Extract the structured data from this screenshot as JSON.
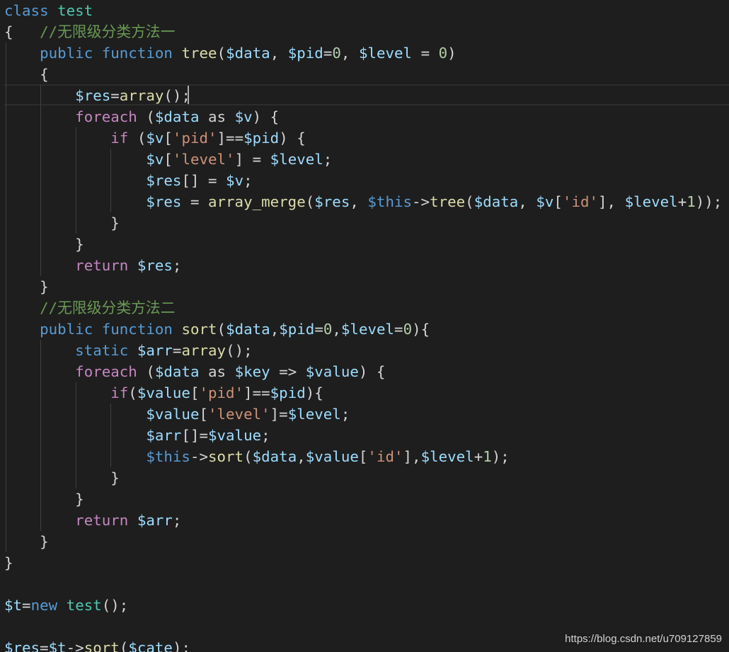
{
  "colors": {
    "background": "#1e1e1e",
    "keyword": "#569cd6",
    "control": "#c586c0",
    "class_name": "#4ec9b0",
    "function_name": "#dcdcaa",
    "variable": "#9cdcfe",
    "string": "#ce9178",
    "number": "#b5cea8",
    "comment": "#6a9955",
    "text": "#d4d4d4"
  },
  "code_lines": [
    [
      {
        "t": "kw",
        "v": "class"
      },
      {
        "t": "punc",
        "v": " "
      },
      {
        "t": "cls",
        "v": "test"
      }
    ],
    [
      {
        "t": "punc",
        "v": "{   "
      },
      {
        "t": "cmt",
        "v": "//无限级分类方法一"
      }
    ],
    [
      {
        "t": "punc",
        "v": "    "
      },
      {
        "t": "kw",
        "v": "public"
      },
      {
        "t": "punc",
        "v": " "
      },
      {
        "t": "kw",
        "v": "function"
      },
      {
        "t": "punc",
        "v": " "
      },
      {
        "t": "fn",
        "v": "tree"
      },
      {
        "t": "punc",
        "v": "("
      },
      {
        "t": "var",
        "v": "$data"
      },
      {
        "t": "punc",
        "v": ", "
      },
      {
        "t": "var",
        "v": "$pid"
      },
      {
        "t": "punc",
        "v": "="
      },
      {
        "t": "num",
        "v": "0"
      },
      {
        "t": "punc",
        "v": ", "
      },
      {
        "t": "var",
        "v": "$level"
      },
      {
        "t": "punc",
        "v": " = "
      },
      {
        "t": "num",
        "v": "0"
      },
      {
        "t": "punc",
        "v": ")"
      }
    ],
    [
      {
        "t": "punc",
        "v": "    {"
      }
    ],
    [
      {
        "t": "punc",
        "v": "        "
      },
      {
        "t": "var",
        "v": "$res"
      },
      {
        "t": "punc",
        "v": "="
      },
      {
        "t": "fn",
        "v": "array"
      },
      {
        "t": "punc",
        "v": "();"
      }
    ],
    [
      {
        "t": "punc",
        "v": "        "
      },
      {
        "t": "ctrl",
        "v": "foreach"
      },
      {
        "t": "punc",
        "v": " ("
      },
      {
        "t": "var",
        "v": "$data"
      },
      {
        "t": "punc",
        "v": " as "
      },
      {
        "t": "var",
        "v": "$v"
      },
      {
        "t": "punc",
        "v": ") {"
      }
    ],
    [
      {
        "t": "punc",
        "v": "            "
      },
      {
        "t": "ctrl",
        "v": "if"
      },
      {
        "t": "punc",
        "v": " ("
      },
      {
        "t": "var",
        "v": "$v"
      },
      {
        "t": "punc",
        "v": "["
      },
      {
        "t": "str",
        "v": "'pid'"
      },
      {
        "t": "punc",
        "v": "]=="
      },
      {
        "t": "var",
        "v": "$pid"
      },
      {
        "t": "punc",
        "v": ") {"
      }
    ],
    [
      {
        "t": "punc",
        "v": "                "
      },
      {
        "t": "var",
        "v": "$v"
      },
      {
        "t": "punc",
        "v": "["
      },
      {
        "t": "str",
        "v": "'level'"
      },
      {
        "t": "punc",
        "v": "] = "
      },
      {
        "t": "var",
        "v": "$level"
      },
      {
        "t": "punc",
        "v": ";"
      }
    ],
    [
      {
        "t": "punc",
        "v": "                "
      },
      {
        "t": "var",
        "v": "$res"
      },
      {
        "t": "punc",
        "v": "[] = "
      },
      {
        "t": "var",
        "v": "$v"
      },
      {
        "t": "punc",
        "v": ";"
      }
    ],
    [
      {
        "t": "punc",
        "v": "                "
      },
      {
        "t": "var",
        "v": "$res"
      },
      {
        "t": "punc",
        "v": " = "
      },
      {
        "t": "fn",
        "v": "array_merge"
      },
      {
        "t": "punc",
        "v": "("
      },
      {
        "t": "var",
        "v": "$res"
      },
      {
        "t": "punc",
        "v": ", "
      },
      {
        "t": "this",
        "v": "$this"
      },
      {
        "t": "punc",
        "v": "->"
      },
      {
        "t": "fn",
        "v": "tree"
      },
      {
        "t": "punc",
        "v": "("
      },
      {
        "t": "var",
        "v": "$data"
      },
      {
        "t": "punc",
        "v": ", "
      },
      {
        "t": "var",
        "v": "$v"
      },
      {
        "t": "punc",
        "v": "["
      },
      {
        "t": "str",
        "v": "'id'"
      },
      {
        "t": "punc",
        "v": "], "
      },
      {
        "t": "var",
        "v": "$level"
      },
      {
        "t": "punc",
        "v": "+"
      },
      {
        "t": "num",
        "v": "1"
      },
      {
        "t": "punc",
        "v": "));"
      }
    ],
    [
      {
        "t": "punc",
        "v": "            }"
      }
    ],
    [
      {
        "t": "punc",
        "v": "        }"
      }
    ],
    [
      {
        "t": "punc",
        "v": "        "
      },
      {
        "t": "ctrl",
        "v": "return"
      },
      {
        "t": "punc",
        "v": " "
      },
      {
        "t": "var",
        "v": "$res"
      },
      {
        "t": "punc",
        "v": ";"
      }
    ],
    [
      {
        "t": "punc",
        "v": "    }"
      }
    ],
    [
      {
        "t": "punc",
        "v": "    "
      },
      {
        "t": "cmt",
        "v": "//无限级分类方法二"
      }
    ],
    [
      {
        "t": "punc",
        "v": "    "
      },
      {
        "t": "kw",
        "v": "public"
      },
      {
        "t": "punc",
        "v": " "
      },
      {
        "t": "kw",
        "v": "function"
      },
      {
        "t": "punc",
        "v": " "
      },
      {
        "t": "fn",
        "v": "sort"
      },
      {
        "t": "punc",
        "v": "("
      },
      {
        "t": "var",
        "v": "$data"
      },
      {
        "t": "punc",
        "v": ","
      },
      {
        "t": "var",
        "v": "$pid"
      },
      {
        "t": "punc",
        "v": "="
      },
      {
        "t": "num",
        "v": "0"
      },
      {
        "t": "punc",
        "v": ","
      },
      {
        "t": "var",
        "v": "$level"
      },
      {
        "t": "punc",
        "v": "="
      },
      {
        "t": "num",
        "v": "0"
      },
      {
        "t": "punc",
        "v": "){"
      }
    ],
    [
      {
        "t": "punc",
        "v": "        "
      },
      {
        "t": "kw",
        "v": "static"
      },
      {
        "t": "punc",
        "v": " "
      },
      {
        "t": "var",
        "v": "$arr"
      },
      {
        "t": "punc",
        "v": "="
      },
      {
        "t": "fn",
        "v": "array"
      },
      {
        "t": "punc",
        "v": "();"
      }
    ],
    [
      {
        "t": "punc",
        "v": "        "
      },
      {
        "t": "ctrl",
        "v": "foreach"
      },
      {
        "t": "punc",
        "v": " ("
      },
      {
        "t": "var",
        "v": "$data"
      },
      {
        "t": "punc",
        "v": " as "
      },
      {
        "t": "var",
        "v": "$key"
      },
      {
        "t": "punc",
        "v": " => "
      },
      {
        "t": "var",
        "v": "$value"
      },
      {
        "t": "punc",
        "v": ") {"
      }
    ],
    [
      {
        "t": "punc",
        "v": "            "
      },
      {
        "t": "ctrl",
        "v": "if"
      },
      {
        "t": "punc",
        "v": "("
      },
      {
        "t": "var",
        "v": "$value"
      },
      {
        "t": "punc",
        "v": "["
      },
      {
        "t": "str",
        "v": "'pid'"
      },
      {
        "t": "punc",
        "v": "]=="
      },
      {
        "t": "var",
        "v": "$pid"
      },
      {
        "t": "punc",
        "v": "){"
      }
    ],
    [
      {
        "t": "punc",
        "v": "                "
      },
      {
        "t": "var",
        "v": "$value"
      },
      {
        "t": "punc",
        "v": "["
      },
      {
        "t": "str",
        "v": "'level'"
      },
      {
        "t": "punc",
        "v": "]="
      },
      {
        "t": "var",
        "v": "$level"
      },
      {
        "t": "punc",
        "v": ";"
      }
    ],
    [
      {
        "t": "punc",
        "v": "                "
      },
      {
        "t": "var",
        "v": "$arr"
      },
      {
        "t": "punc",
        "v": "[]="
      },
      {
        "t": "var",
        "v": "$value"
      },
      {
        "t": "punc",
        "v": ";"
      }
    ],
    [
      {
        "t": "punc",
        "v": "                "
      },
      {
        "t": "this",
        "v": "$this"
      },
      {
        "t": "punc",
        "v": "->"
      },
      {
        "t": "fn",
        "v": "sort"
      },
      {
        "t": "punc",
        "v": "("
      },
      {
        "t": "var",
        "v": "$data"
      },
      {
        "t": "punc",
        "v": ","
      },
      {
        "t": "var",
        "v": "$value"
      },
      {
        "t": "punc",
        "v": "["
      },
      {
        "t": "str",
        "v": "'id'"
      },
      {
        "t": "punc",
        "v": "],"
      },
      {
        "t": "var",
        "v": "$level"
      },
      {
        "t": "punc",
        "v": "+"
      },
      {
        "t": "num",
        "v": "1"
      },
      {
        "t": "punc",
        "v": ");"
      }
    ],
    [
      {
        "t": "punc",
        "v": "            }"
      }
    ],
    [
      {
        "t": "punc",
        "v": "        }"
      }
    ],
    [
      {
        "t": "punc",
        "v": "        "
      },
      {
        "t": "ctrl",
        "v": "return"
      },
      {
        "t": "punc",
        "v": " "
      },
      {
        "t": "var",
        "v": "$arr"
      },
      {
        "t": "punc",
        "v": ";"
      }
    ],
    [
      {
        "t": "punc",
        "v": "    }"
      }
    ],
    [
      {
        "t": "punc",
        "v": "}"
      }
    ],
    [],
    [
      {
        "t": "var",
        "v": "$t"
      },
      {
        "t": "punc",
        "v": "="
      },
      {
        "t": "kw",
        "v": "new"
      },
      {
        "t": "punc",
        "v": " "
      },
      {
        "t": "cls",
        "v": "test"
      },
      {
        "t": "punc",
        "v": "();"
      }
    ],
    [],
    [
      {
        "t": "var",
        "v": "$res"
      },
      {
        "t": "punc",
        "v": "="
      },
      {
        "t": "var",
        "v": "$t"
      },
      {
        "t": "punc",
        "v": "->"
      },
      {
        "t": "fn",
        "v": "sort"
      },
      {
        "t": "punc",
        "v": "("
      },
      {
        "t": "var",
        "v": "$cate"
      },
      {
        "t": "punc",
        "v": ");"
      }
    ]
  ],
  "watermark": "https://blog.csdn.net/u709127859"
}
